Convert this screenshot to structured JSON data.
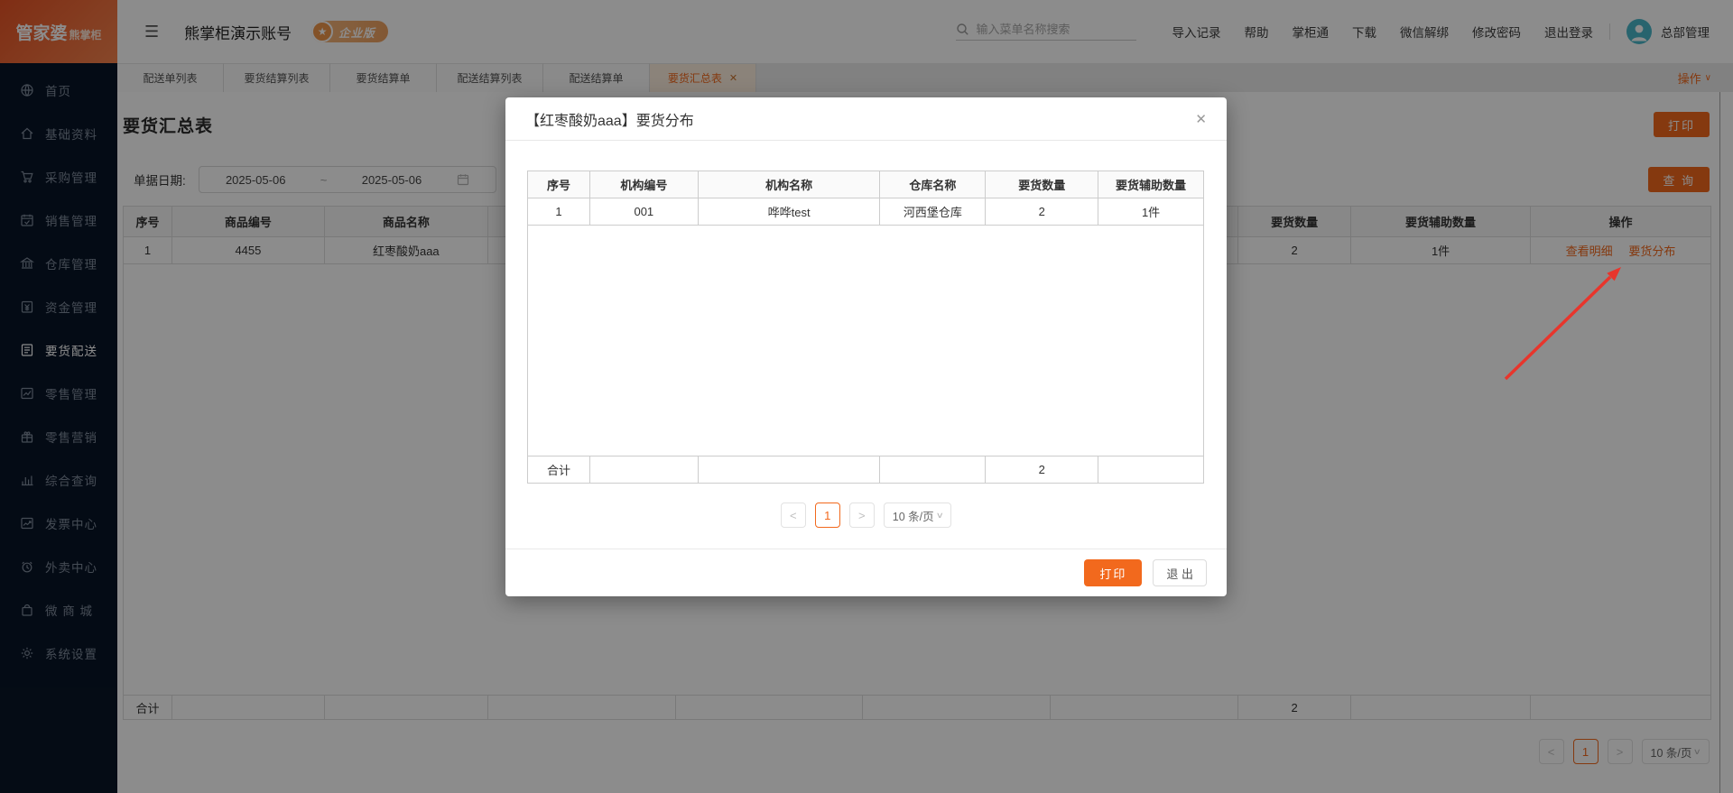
{
  "colors": {
    "accent": "#f2691d",
    "sidebar_bg": "#091527",
    "logo_gradient_from": "#e85325",
    "logo_gradient_to": "#f5834d",
    "active_tab_bg": "#fdeede",
    "link": "#f2691d",
    "annotation_arrow": "#e8352c",
    "avatar_bg": "#49b6c8"
  },
  "brand": {
    "name": "管家婆",
    "sub": "熊掌柜"
  },
  "header": {
    "menu_icon": "☰",
    "account_title": "熊掌柜演示账号",
    "badge_star": "★",
    "badge_label": "企业版",
    "search_placeholder": "输入菜单名称搜索",
    "links": [
      "导入记录",
      "帮助",
      "掌柜通",
      "下载",
      "微信解绑",
      "修改密码",
      "退出登录"
    ],
    "user_name": "总部管理"
  },
  "sidebar": {
    "items": [
      {
        "label": "首页"
      },
      {
        "label": "基础资料"
      },
      {
        "label": "采购管理"
      },
      {
        "label": "销售管理"
      },
      {
        "label": "仓库管理"
      },
      {
        "label": "资金管理"
      },
      {
        "label": "要货配送",
        "active": true
      },
      {
        "label": "零售管理"
      },
      {
        "label": "零售营销"
      },
      {
        "label": "综合查询"
      },
      {
        "label": "发票中心"
      },
      {
        "label": "外卖中心"
      },
      {
        "label": "微 商 城"
      },
      {
        "label": "系统设置"
      }
    ]
  },
  "tabbar": {
    "tabs": [
      {
        "label": "配送单列表"
      },
      {
        "label": "要货结算列表"
      },
      {
        "label": "要货结算单"
      },
      {
        "label": "配送结算列表"
      },
      {
        "label": "配送结算单"
      },
      {
        "label": "要货汇总表",
        "active": true
      }
    ],
    "close_glyph": "✕",
    "actions_label": "操作",
    "actions_caret": "∨"
  },
  "page": {
    "title": "要货汇总表",
    "print_button": "打印",
    "query_button": "查 询",
    "filter": {
      "date_label": "单据日期:",
      "date_from": "2025-05-06",
      "tilde": "~",
      "date_to": "2025-05-06"
    },
    "table": {
      "headers": [
        "序号",
        "商品编号",
        "商品名称",
        "",
        "",
        "",
        "",
        "要货数量",
        "要货辅助数量",
        "操作"
      ],
      "row": {
        "cells": [
          "1",
          "4455",
          "红枣酸奶aaa",
          "",
          "",
          "",
          "",
          "2",
          "1件"
        ],
        "actions": [
          "查看明细",
          "要货分布"
        ]
      },
      "total_label": "合计",
      "total_qty": "2"
    },
    "pagination": {
      "prev": "<",
      "page": "1",
      "next": ">",
      "size": "10 条/页",
      "caret": "∨"
    }
  },
  "modal": {
    "title": "【红枣酸奶aaa】要货分布",
    "close_glyph": "✕",
    "table": {
      "headers": [
        "序号",
        "机构编号",
        "机构名称",
        "仓库名称",
        "要货数量",
        "要货辅助数量"
      ],
      "row": [
        "1",
        "001",
        "哗哗test",
        "河西堡仓库",
        "2",
        "1件"
      ],
      "total_label": "合计",
      "total_qty": "2"
    },
    "pagination": {
      "prev": "<",
      "page": "1",
      "next": ">",
      "size": "10 条/页",
      "caret": "∨"
    },
    "print_button": "打印",
    "exit_button": "退 出"
  }
}
